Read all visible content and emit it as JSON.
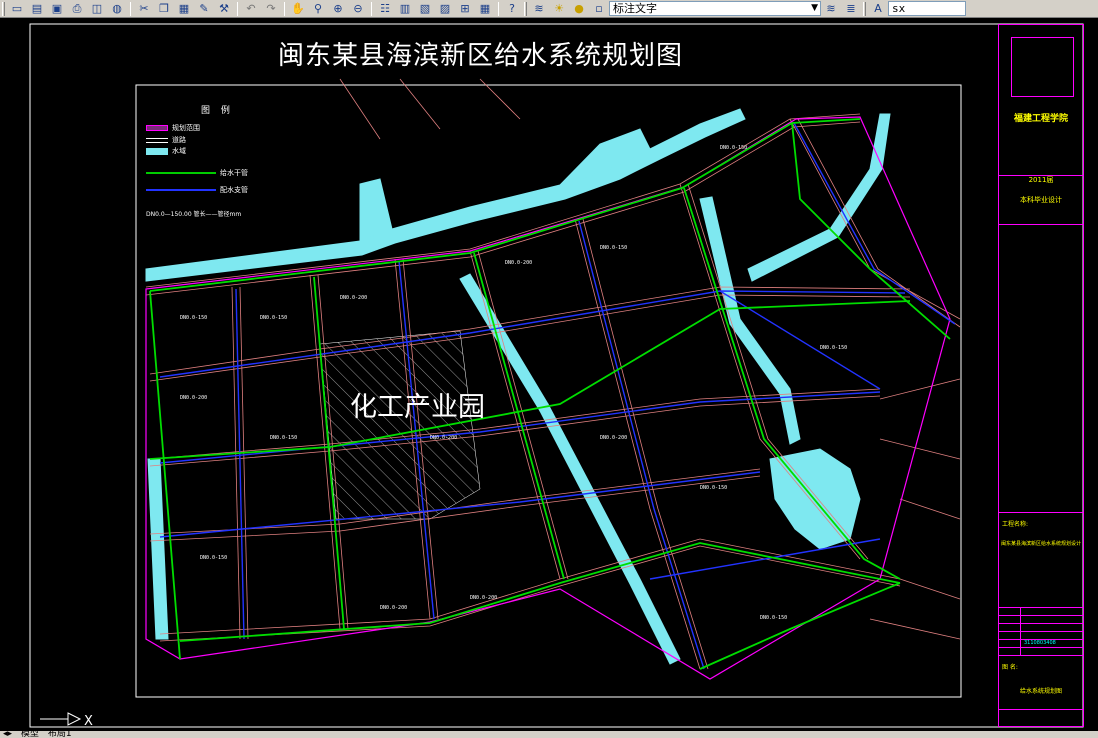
{
  "toolbar": {
    "text_style": "标注文字",
    "search_value": "sx",
    "icons": [
      "qnew-icon",
      "open-icon",
      "save-icon",
      "plot-icon",
      "preview-icon",
      "publish-icon",
      "cut-icon",
      "copy-icon",
      "paste-icon",
      "matchprop-icon",
      "blockeditor-icon",
      "undo-icon",
      "redo-icon",
      "pan-icon",
      "zoom-realtime-icon",
      "zoom-window-icon",
      "zoom-previous-icon",
      "properties-icon",
      "designcenter-icon",
      "toolpalettes-icon",
      "sheetset-icon",
      "markup-icon",
      "calculator-icon",
      "help-icon",
      "layer-icon",
      "layer-state-icon",
      "text-style-icon",
      "annotation-icon"
    ]
  },
  "drawing": {
    "title": "闽东某县海滨新区给水系统规划图",
    "zone_label": "化工产业园"
  },
  "legend": {
    "title": "图 例",
    "items": [
      {
        "label": "规划范围",
        "type": "boundary",
        "color": "#ff00ff"
      },
      {
        "label": "道路",
        "type": "road",
        "color": "#ffffff"
      },
      {
        "label": "水域",
        "type": "water",
        "color": "#7ee8f0"
      },
      {
        "label": "给水干管",
        "type": "main-pipe",
        "color": "#00cc00"
      },
      {
        "label": "配水支管",
        "type": "branch-pipe",
        "color": "#2233ff"
      }
    ],
    "note": "DN0.0—150.00   管长——管径mm"
  },
  "title_block": {
    "school": "福建工程学院",
    "year": "2011届",
    "design_type": "本科毕业设计",
    "project_label": "工程名称:",
    "project_name": "闽东某县海滨新区给水系统规划设计",
    "drawing_name": "给水系统规划图",
    "drawing_label": "图 名:",
    "student_id": "3110803408"
  },
  "layout_tabs": [
    "模型",
    "布局1"
  ],
  "colors": {
    "road": "#e0a0a0",
    "pipe_main": "#00dd00",
    "pipe_branch": "#2233ff",
    "water": "#7ee8f0",
    "frame": "#ff00ff"
  }
}
